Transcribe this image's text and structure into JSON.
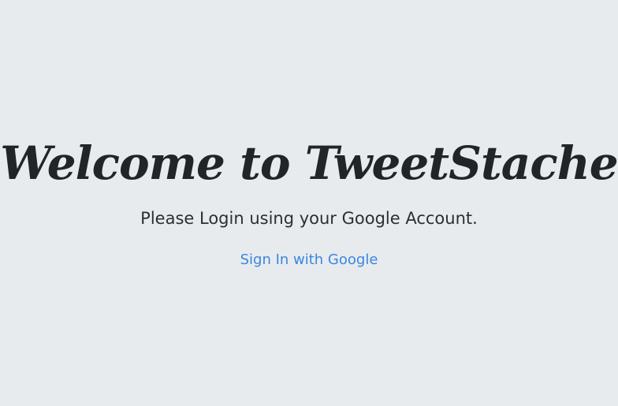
{
  "main": {
    "title": "Welcome to TweetStache",
    "subtitle": "Please Login using your Google Account.",
    "signin_link": "Sign In with Google"
  },
  "colors": {
    "background": "#e8ebee",
    "text": "#212529",
    "link": "#3a86e0"
  }
}
